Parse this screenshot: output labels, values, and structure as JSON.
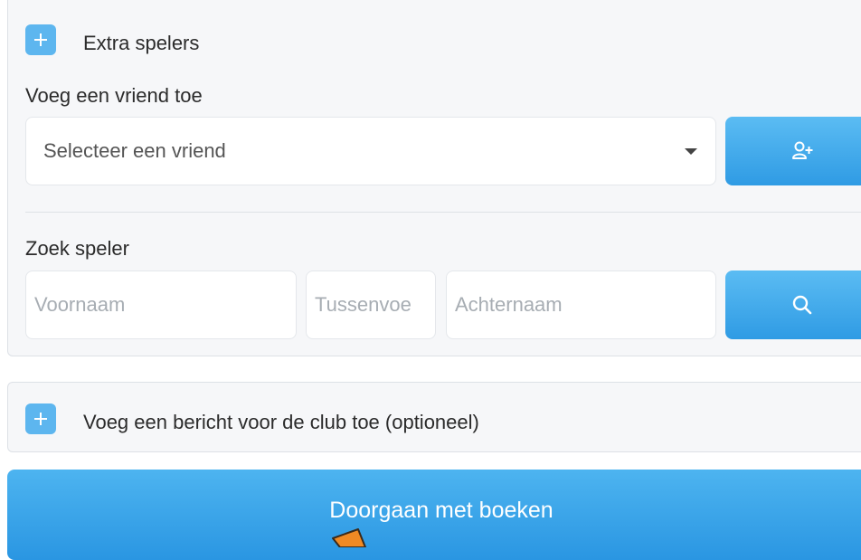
{
  "extra_players": {
    "title": "Extra spelers",
    "friend_section_label": "Voeg een vriend toe",
    "friend_select_value": "Selecteer een vriend",
    "search_section_label": "Zoek speler",
    "firstname_placeholder": "Voornaam",
    "infix_placeholder": "Tussenvoe",
    "lastname_placeholder": "Achternaam"
  },
  "message": {
    "title": "Voeg een bericht voor de club toe (optioneel)"
  },
  "continue_label": "Doorgaan met boeken",
  "icons": {
    "expand_players": "plus-icon",
    "add_friend": "user-plus-icon",
    "search": "search-icon",
    "expand_message": "plus-icon",
    "cursor": "arrow-cursor-icon"
  },
  "colors": {
    "accent": "#3aa6ea",
    "panel_bg": "#f6f7f9",
    "border": "#dde1e6"
  }
}
